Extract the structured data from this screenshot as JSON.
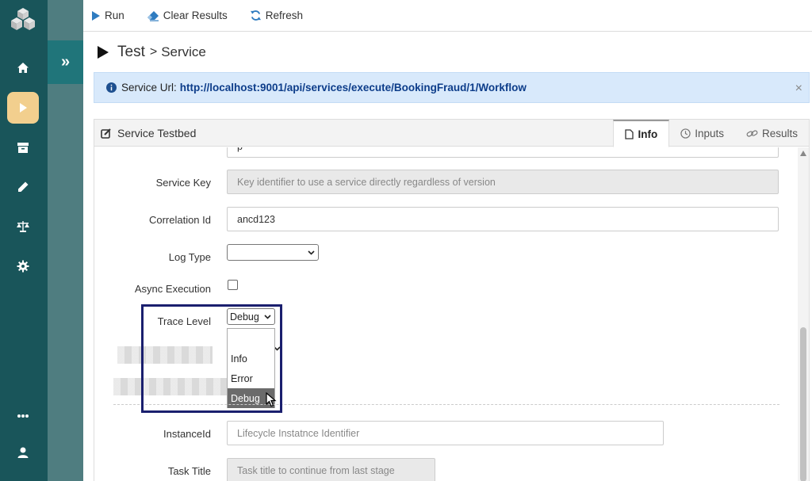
{
  "toolbar": {
    "run_label": "Run",
    "clear_label": "Clear Results",
    "refresh_label": "Refresh"
  },
  "breadcrumb": {
    "root": "Test",
    "separator": ">",
    "current": "Service"
  },
  "alert": {
    "prefix": "Service Url:",
    "url": "http://localhost:9001/api/services/execute/BookingFraud/1/Workflow",
    "close": "×"
  },
  "panel": {
    "title": "Service Testbed",
    "tabs": [
      {
        "label": "Info",
        "active": true
      },
      {
        "label": "Inputs"
      },
      {
        "label": "Results"
      }
    ]
  },
  "form": {
    "top_field_partial": "p",
    "service_key": {
      "label": "Service Key",
      "placeholder": "Key identifier to use a service directly regardless of version"
    },
    "correlation_id": {
      "label": "Correlation Id",
      "value": "ancd123"
    },
    "log_type": {
      "label": "Log Type",
      "value": ""
    },
    "async_execution": {
      "label": "Async Execution",
      "checked": false
    },
    "trace_level": {
      "label": "Trace Level",
      "value": "Debug",
      "options": [
        "",
        "Info",
        "Error",
        "Debug"
      ]
    },
    "instance_id": {
      "label": "InstanceId",
      "placeholder": "Lifecycle Instatnce Identifier"
    },
    "task_title": {
      "label": "Task Title",
      "placeholder": "Task title to continue from last stage"
    }
  },
  "colors": {
    "nav_bg": "#19555a",
    "nav_active": "#f2cf8e",
    "strip_bg": "#4f7d80",
    "expand_bg": "#20757a",
    "alert_bg": "#d8e9fb",
    "highlight": "#1a1f6e",
    "accent_blue": "#2f7cc0"
  }
}
